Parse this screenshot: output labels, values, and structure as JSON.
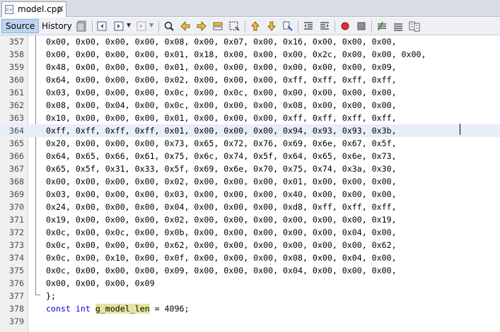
{
  "tab": {
    "title": "model.cpp",
    "close": "×"
  },
  "toolbar": {
    "source_label": "Source",
    "history_label": "History"
  },
  "lines": [
    {
      "num": "357",
      "text": "0x00, 0x00, 0x00, 0x00, 0x08, 0x00, 0x07, 0x00, 0x16, 0x00, 0x00, 0x00,"
    },
    {
      "num": "358",
      "text": "0x00, 0x00, 0x00, 0x00, 0x01, 0x18, 0x00, 0x00, 0x00, 0x2c, 0x00, 0x00, 0x00,"
    },
    {
      "num": "359",
      "text": "0x48, 0x00, 0x00, 0x00, 0x01, 0x00, 0x00, 0x00, 0x00, 0x00, 0x00, 0x09,"
    },
    {
      "num": "360",
      "text": "0x64, 0x00, 0x00, 0x00, 0x02, 0x00, 0x00, 0x00, 0xff, 0xff, 0xff, 0xff,"
    },
    {
      "num": "361",
      "text": "0x03, 0x00, 0x00, 0x00, 0x0c, 0x00, 0x0c, 0x00, 0x00, 0x00, 0x00, 0x00,"
    },
    {
      "num": "362",
      "text": "0x08, 0x00, 0x04, 0x00, 0x0c, 0x00, 0x00, 0x00, 0x08, 0x00, 0x00, 0x00,"
    },
    {
      "num": "363",
      "text": "0x10, 0x00, 0x00, 0x00, 0x01, 0x00, 0x00, 0x00, 0xff, 0xff, 0xff, 0xff,"
    },
    {
      "num": "364",
      "text": "0xff, 0xff, 0xff, 0xff, 0x01, 0x00, 0x00, 0x00, 0x94, 0x93, 0x93, 0x3b,"
    },
    {
      "num": "365",
      "text": "0x20, 0x00, 0x00, 0x00, 0x73, 0x65, 0x72, 0x76, 0x69, 0x6e, 0x67, 0x5f,"
    },
    {
      "num": "366",
      "text": "0x64, 0x65, 0x66, 0x61, 0x75, 0x6c, 0x74, 0x5f, 0x64, 0x65, 0x6e, 0x73,"
    },
    {
      "num": "367",
      "text": "0x65, 0x5f, 0x31, 0x33, 0x5f, 0x69, 0x6e, 0x70, 0x75, 0x74, 0x3a, 0x30,"
    },
    {
      "num": "368",
      "text": "0x00, 0x00, 0x00, 0x00, 0x02, 0x00, 0x00, 0x00, 0x01, 0x00, 0x00, 0x00,"
    },
    {
      "num": "369",
      "text": "0x03, 0x00, 0x00, 0x00, 0x03, 0x00, 0x00, 0x00, 0x40, 0x00, 0x00, 0x00,"
    },
    {
      "num": "370",
      "text": "0x24, 0x00, 0x00, 0x00, 0x04, 0x00, 0x00, 0x00, 0xd8, 0xff, 0xff, 0xff,"
    },
    {
      "num": "371",
      "text": "0x19, 0x00, 0x00, 0x00, 0x02, 0x00, 0x00, 0x00, 0x00, 0x00, 0x00, 0x19,"
    },
    {
      "num": "372",
      "text": "0x0c, 0x00, 0x0c, 0x00, 0x0b, 0x00, 0x00, 0x00, 0x00, 0x00, 0x04, 0x00,"
    },
    {
      "num": "373",
      "text": "0x0c, 0x00, 0x00, 0x00, 0x62, 0x00, 0x00, 0x00, 0x00, 0x00, 0x00, 0x62,"
    },
    {
      "num": "374",
      "text": "0x0c, 0x00, 0x10, 0x00, 0x0f, 0x00, 0x00, 0x00, 0x08, 0x00, 0x04, 0x00,"
    },
    {
      "num": "375",
      "text": "0x0c, 0x00, 0x00, 0x00, 0x09, 0x00, 0x00, 0x00, 0x04, 0x00, 0x00, 0x00,"
    },
    {
      "num": "376",
      "text": "0x00, 0x00, 0x00, 0x09"
    },
    {
      "num": "377",
      "text": "};"
    },
    {
      "num": "378",
      "kw1": "const",
      "kw2": "int",
      "ident": "g_model_len",
      "rest": " = 4096;"
    },
    {
      "num": "379",
      "text": ""
    }
  ],
  "icons": [
    "file-cpp-icon",
    "history-icon",
    "back-icon",
    "forward-icon",
    "find-icon",
    "find-prev-icon",
    "find-next-icon",
    "toggle-highlight-icon",
    "rect-select-icon",
    "prev-bookmark-icon",
    "next-bookmark-icon",
    "toggle-bookmark-icon",
    "shift-left-icon",
    "shift-right-icon",
    "record-macro-icon",
    "stop-macro-icon",
    "comment-icon",
    "uncomment-icon",
    "diff-icon"
  ],
  "colors": {
    "keyword": "#0000e6",
    "ident_highlight": "#e4e4a0",
    "current_line": "#e8eef8",
    "source_active": "#bcd4f0"
  }
}
